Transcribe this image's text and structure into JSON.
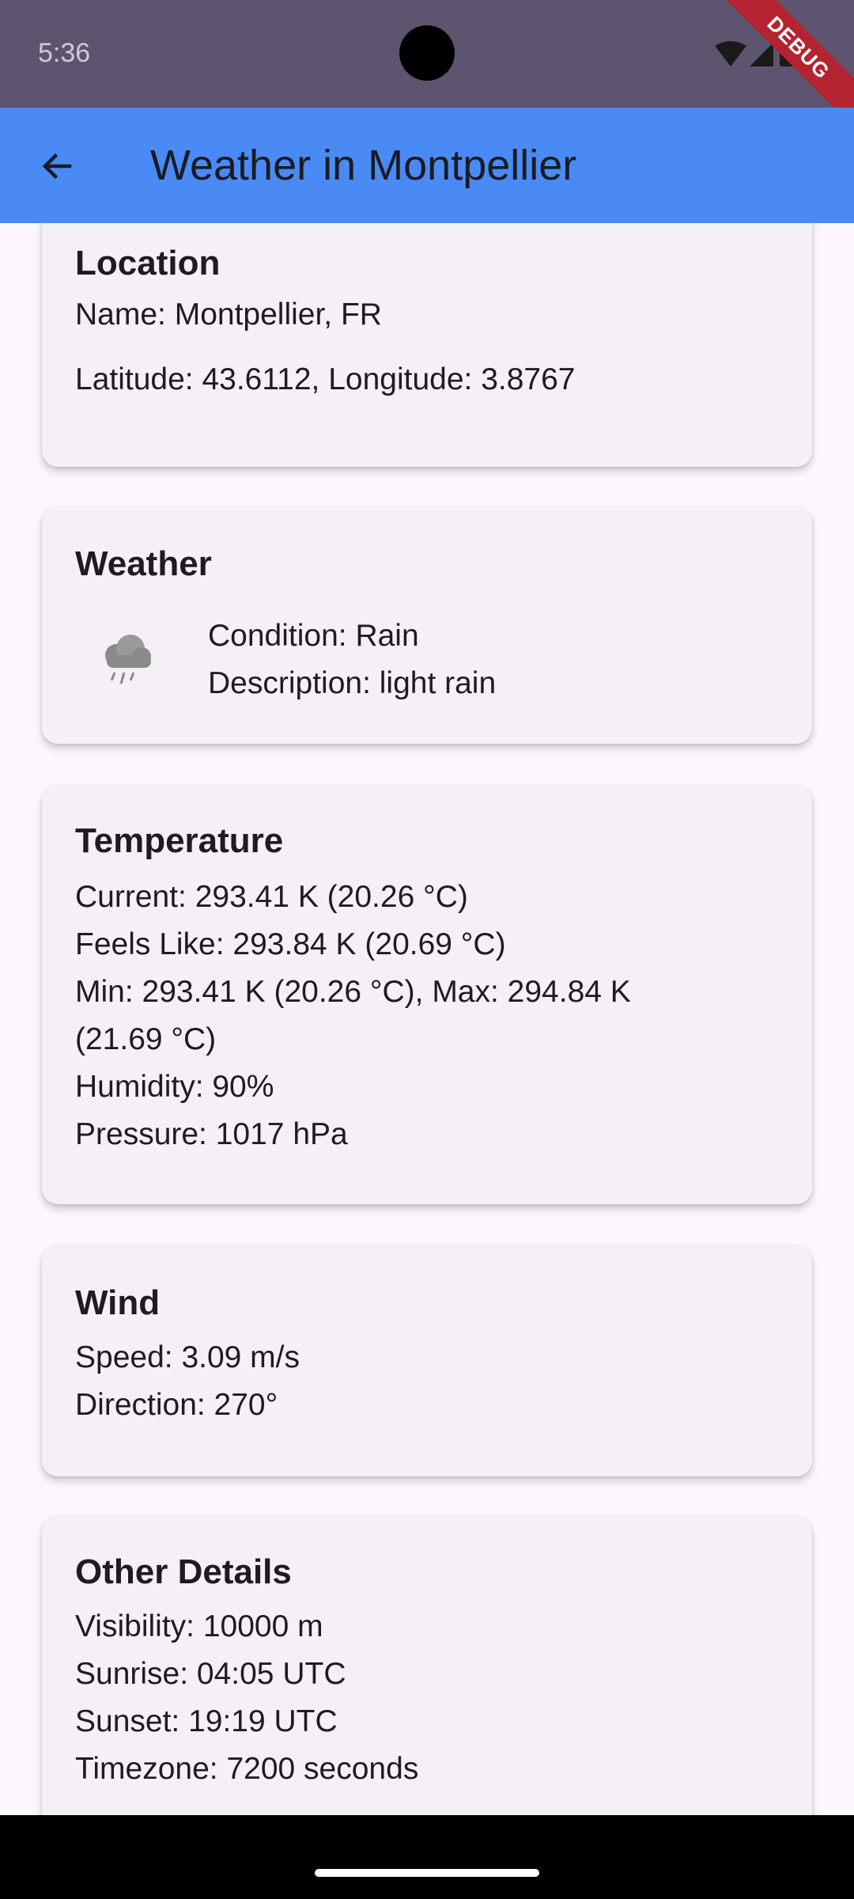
{
  "status_bar": {
    "time": "5:36",
    "debug_label": "DEBUG"
  },
  "app_bar": {
    "title": "Weather in Montpellier",
    "back_icon": "arrow-back-icon"
  },
  "location": {
    "title": "Location",
    "name": "Name: Montpellier, FR",
    "coords": "Latitude: 43.6112, Longitude: 3.8767"
  },
  "weather": {
    "title": "Weather",
    "icon": "rain-cloud-icon",
    "condition": "Condition: Rain",
    "description": "Description: light rain"
  },
  "temperature": {
    "title": "Temperature",
    "current": "Current: 293.41 K (20.26 °C)",
    "feels_like": "Feels Like: 293.84 K (20.69 °C)",
    "min_max_1": "Min: 293.41 K (20.26 °C), Max: 294.84 K",
    "min_max_2": "(21.69 °C)",
    "humidity": "Humidity: 90%",
    "pressure": "Pressure: 1017 hPa"
  },
  "wind": {
    "title": "Wind",
    "speed": "Speed: 3.09 m/s",
    "direction": "Direction: 270°"
  },
  "other": {
    "title": "Other Details",
    "visibility": "Visibility: 10000 m",
    "sunrise": "Sunrise: 04:05 UTC",
    "sunset": "Sunset: 19:19 UTC",
    "timezone": "Timezone: 7200 seconds"
  },
  "colors": {
    "status_bar": "#5f546f",
    "app_bar": "#4a8af4",
    "card": "#f5eff6",
    "background": "#fdf7fd",
    "debug_banner": "#b4232f"
  }
}
